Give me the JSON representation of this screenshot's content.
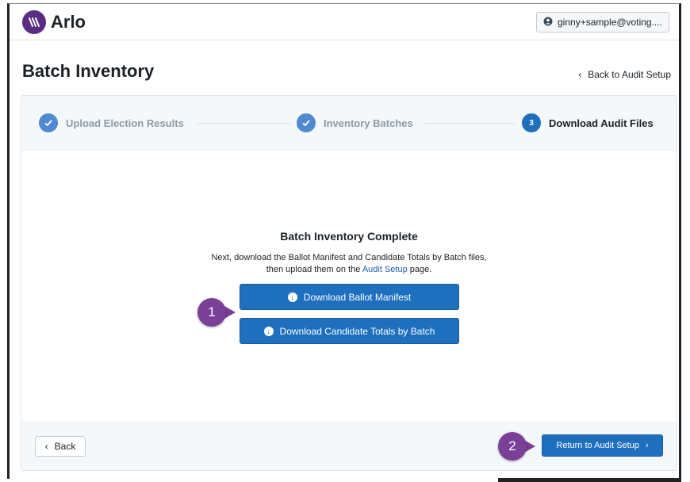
{
  "app": {
    "name": "Arlo"
  },
  "user": {
    "label": "ginny+sample@voting...."
  },
  "page": {
    "title": "Batch Inventory",
    "back_link": "Back to Audit Setup"
  },
  "stepper": {
    "steps": [
      {
        "label": "Upload Election Results",
        "status": "done"
      },
      {
        "label": "Inventory Batches",
        "status": "done"
      },
      {
        "label": "Download Audit Files",
        "number": "3",
        "status": "active"
      }
    ]
  },
  "content": {
    "title": "Batch Inventory Complete",
    "desc_line1": "Next, download the Ballot Manifest and Candidate Totals by Batch files,",
    "desc_line2_pre": "then upload them on the ",
    "desc_link": "Audit Setup",
    "desc_line2_post": " page.",
    "download_manifest": "Download Ballot Manifest",
    "download_totals": "Download Candidate Totals by Batch"
  },
  "footer": {
    "back": "Back",
    "return": "Return to Audit Setup"
  },
  "callouts": {
    "one": "1",
    "two": "2"
  },
  "colors": {
    "primary": "#1f6fbf",
    "brand": "#5b2c83",
    "callout": "#7a3f97",
    "done_step": "#4f8ad0"
  }
}
